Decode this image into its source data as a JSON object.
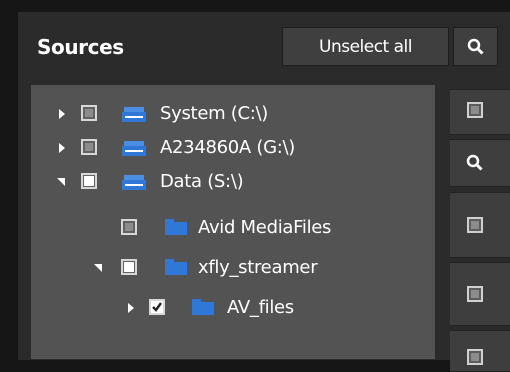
{
  "panel": {
    "title": "Sources",
    "unselect_all_label": "Unselect all"
  },
  "tree": {
    "items": [
      {
        "label": "System (C:\\)",
        "type": "drive",
        "expanded": false,
        "checked": false
      },
      {
        "label": "A234860A (G:\\)",
        "type": "drive",
        "expanded": false,
        "checked": false
      },
      {
        "label": "Data (S:\\)",
        "type": "drive",
        "expanded": true,
        "checked": "partial"
      },
      {
        "label": "Avid MediaFiles",
        "type": "folder",
        "expanded": null,
        "checked": false
      },
      {
        "label": "xfly_streamer",
        "type": "folder",
        "expanded": true,
        "checked": "partial"
      },
      {
        "label": "AV_files",
        "type": "folder",
        "expanded": false,
        "checked": true
      }
    ]
  },
  "colors": {
    "background": "#161616",
    "panel": "#2b2b2b",
    "tree_background": "#535353",
    "folder_blue": "#2f78d8",
    "button": "#3f3f3f"
  }
}
